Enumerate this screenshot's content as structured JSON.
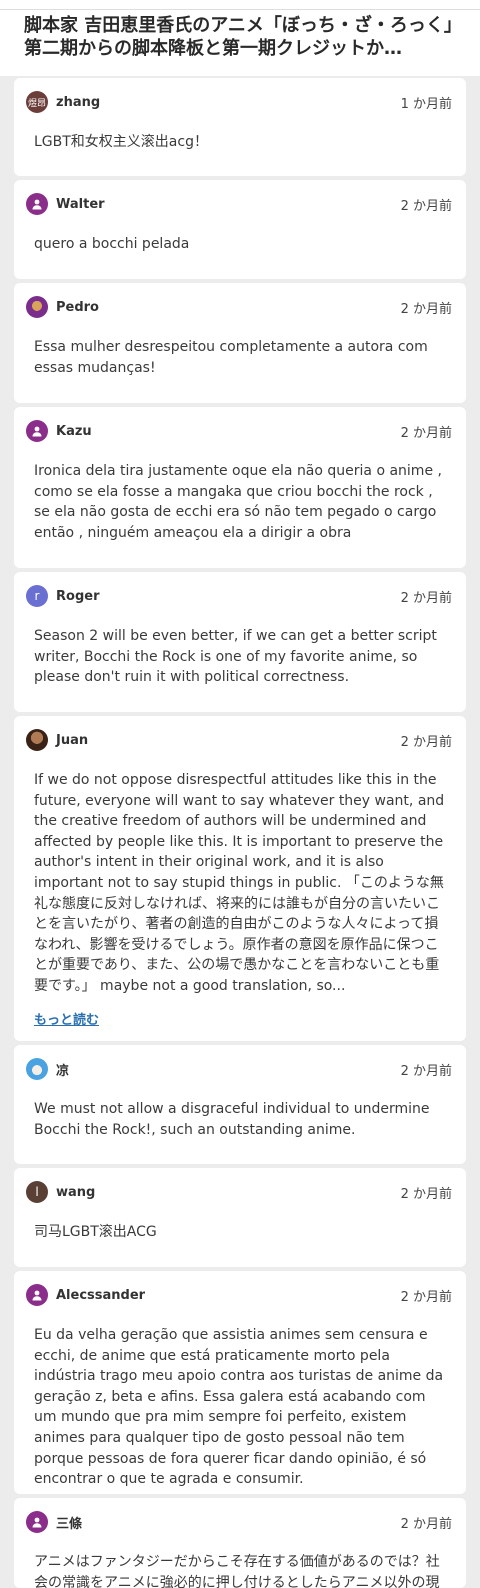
{
  "article": {
    "title": "脚本家 吉田恵里香氏のアニメ「ぼっち・ざ・ろっく」第二期からの脚本降板と第一期クレジットか…"
  },
  "comments": [
    {
      "author": "zhang",
      "avatar": {
        "type": "text",
        "text": "煜昂",
        "color": "#6b3e3a"
      },
      "time": "1 か月前",
      "text": "LGBT和女权主义滚出acg！"
    },
    {
      "author": "Walter",
      "avatar": {
        "type": "icon",
        "icon": "user-icon",
        "color": "#8b2d8a"
      },
      "time": "2 か月前",
      "text": "quero a bocchi pelada"
    },
    {
      "author": "Pedro",
      "avatar": {
        "type": "photo"
      },
      "time": "2 か月前",
      "text": "Essa mulher desrespeitou completamente a autora com essas mudanças!"
    },
    {
      "author": "Kazu",
      "avatar": {
        "type": "icon",
        "icon": "user-icon",
        "color": "#8b2d8a"
      },
      "time": "2 か月前",
      "text": "Ironica dela tira justamente oque ela não queria o anime , como se ela fosse a mangaka que criou bocchi the rock , se ela não gosta de ecchi era só não tem pegado o cargo então , ninguém ameaçou ela a dirigir a obra"
    },
    {
      "author": "Roger",
      "avatar": {
        "type": "text",
        "text": "r",
        "color": "#6a6fd2"
      },
      "time": "2 か月前",
      "text": "Season 2 will be even better, if we can get a better script writer, Bocchi the Rock is one of my favorite anime, so please don't ruin it with political correctness."
    },
    {
      "author": "Juan",
      "avatar": {
        "type": "photo"
      },
      "time": "2 か月前",
      "text": "If we do not oppose disrespectful attitudes like this in the future, everyone will want to say whatever they want, and the creative freedom of authors will be undermined and affected by people like this. It is important to preserve the author's intent in their original work, and it is also important not to say stupid things in public. 「このような無礼な態度に反対しなければ、将来的には誰もが自分の言いたいことを言いたがり、著者の創造的自由がこのような人々によって損なわれ、影響を受けるでしょう。原作者の意図を原作品に保つことが重要であり、また、公の場で愚かなことを言わないことも重要です。」 maybe not a good translation, so...",
      "read_more": "もっと読む"
    },
    {
      "author": "凉",
      "avatar": {
        "type": "photo"
      },
      "time": "2 か月前",
      "text": "We must not allow a disgraceful individual to undermine Bocchi the Rock!, such an outstanding anime."
    },
    {
      "author": "wang",
      "avatar": {
        "type": "text",
        "text": "l",
        "color": "#5a4034"
      },
      "time": "2 か月前",
      "text": "司马LGBT滚出ACG"
    },
    {
      "author": "Alecssander",
      "avatar": {
        "type": "icon",
        "icon": "user-icon",
        "color": "#8b2d8a"
      },
      "time": "2 か月前",
      "text": "Eu da velha geração que assistia animes sem censura e ecchi, de anime que está praticamente morto pela indústria trago meu apoio contra aos turistas de anime da geração z, beta e afins. Essa galera está acabando com um mundo que pra mim sempre foi perfeito, existem animes para qualquer tipo de gosto pessoal não tem porque pessoas de fora querer ficar dando opinião, é só encontrar o que te agrada e consumir."
    },
    {
      "author": "三條",
      "avatar": {
        "type": "icon",
        "icon": "user-icon",
        "color": "#8b2d8a"
      },
      "time": "2 か月前",
      "text": "アニメはファンタジーだからこそ存在する価値があるのでは？社会の常識をアニメに強必的に押し付けるとしたらアニメ以外の現実を"
    }
  ]
}
